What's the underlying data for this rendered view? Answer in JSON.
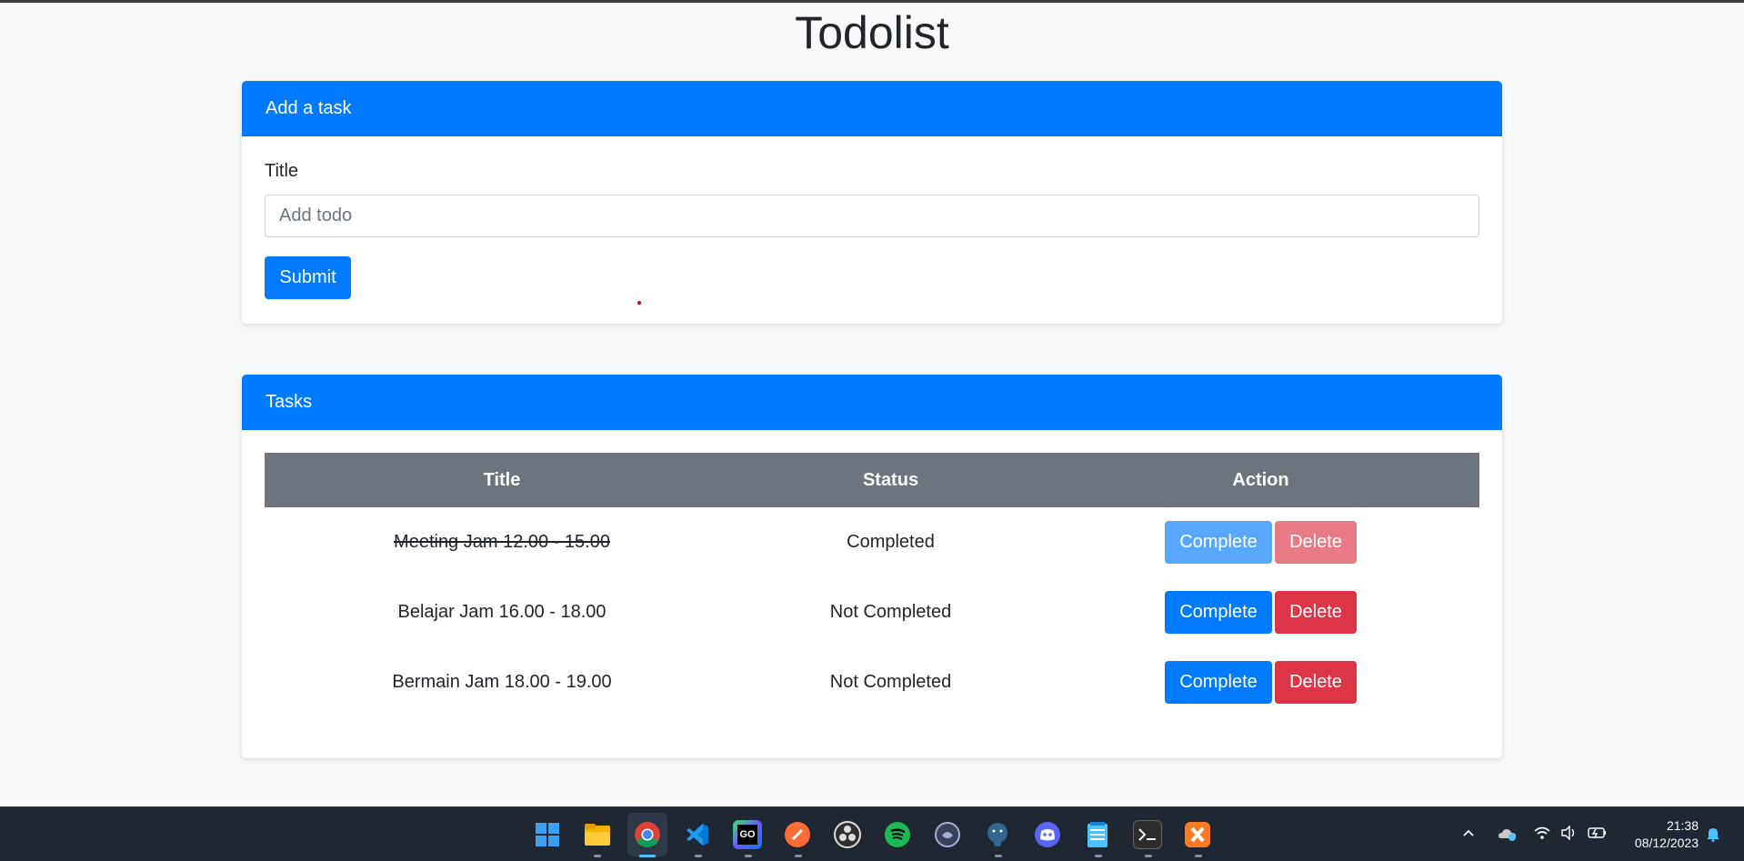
{
  "page": {
    "title": "Todolist"
  },
  "add_card": {
    "header": "Add a task",
    "label": "Title",
    "input_placeholder": "Add todo",
    "input_value": "",
    "submit_label": "Submit"
  },
  "tasks_card": {
    "header": "Tasks",
    "columns": [
      "Title",
      "Status",
      "Action"
    ],
    "rows": [
      {
        "title": "Meeting Jam 12.00 - 15.00",
        "status": "Completed",
        "complete_label": "Complete",
        "delete_label": "Delete"
      },
      {
        "title": "Belajar Jam 16.00 - 18.00",
        "status": "Not Completed",
        "complete_label": "Complete",
        "delete_label": "Delete"
      },
      {
        "title": "Bermain Jam 18.00 - 19.00",
        "status": "Not Completed",
        "complete_label": "Complete",
        "delete_label": "Delete"
      }
    ]
  },
  "colors": {
    "primary": "#007bff",
    "danger": "#dc3545",
    "table_header": "#6c757d",
    "background": "#f8f9fa"
  },
  "taskbar": {
    "apps": [
      "windows-start-icon",
      "file-explorer-icon",
      "chrome-icon",
      "vscode-icon",
      "goland-icon",
      "postman-icon",
      "obs-icon",
      "spotify-icon",
      "cursor-app-icon",
      "postgresql-icon",
      "discord-icon",
      "notepad-icon",
      "terminal-icon",
      "xampp-icon"
    ],
    "time": "21:38",
    "date": "08/12/2023"
  }
}
